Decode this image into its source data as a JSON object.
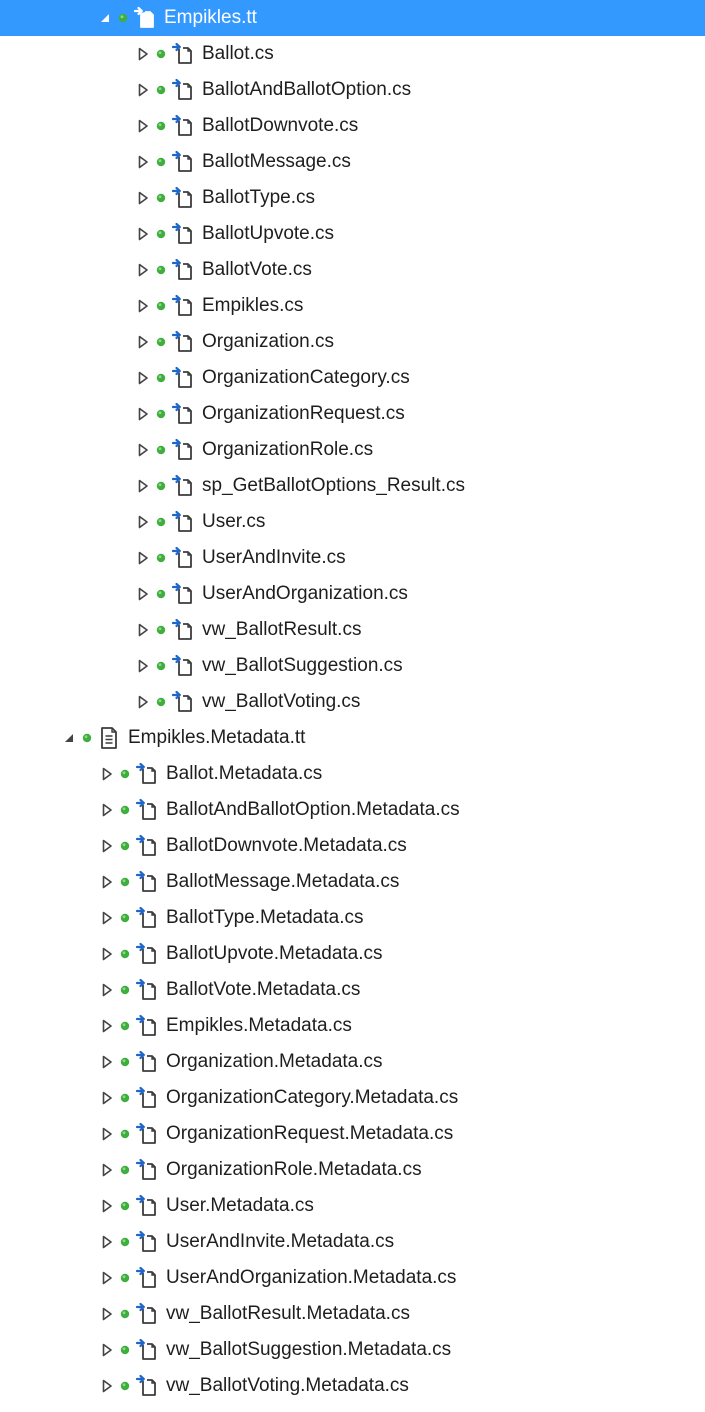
{
  "colors": {
    "selection_bg": "#3399ff",
    "selection_text": "#ffffff",
    "text": "#1e1e1e",
    "status_dot": "#3fae3f",
    "arrow_outline": "#444444",
    "icon_outline": "#3c3c3c",
    "icon_arrow": "#1e66c8"
  },
  "tree": {
    "root_cs": {
      "label": "Empikles.tt",
      "icon": "cs-generated-file-icon",
      "expanded": true,
      "selected": true,
      "children": [
        {
          "label": "Ballot.cs"
        },
        {
          "label": "BallotAndBallotOption.cs"
        },
        {
          "label": "BallotDownvote.cs"
        },
        {
          "label": "BallotMessage.cs"
        },
        {
          "label": "BallotType.cs"
        },
        {
          "label": "BallotUpvote.cs"
        },
        {
          "label": "BallotVote.cs"
        },
        {
          "label": "Empikles.cs"
        },
        {
          "label": "Organization.cs"
        },
        {
          "label": "OrganizationCategory.cs"
        },
        {
          "label": "OrganizationRequest.cs"
        },
        {
          "label": "OrganizationRole.cs"
        },
        {
          "label": "sp_GetBallotOptions_Result.cs"
        },
        {
          "label": "User.cs"
        },
        {
          "label": "UserAndInvite.cs"
        },
        {
          "label": "UserAndOrganization.cs"
        },
        {
          "label": "vw_BallotResult.cs"
        },
        {
          "label": "vw_BallotSuggestion.cs"
        },
        {
          "label": "vw_BallotVoting.cs"
        }
      ]
    },
    "root_meta": {
      "label": "Empikles.Metadata.tt",
      "icon": "text-template-file-icon",
      "expanded": true,
      "selected": false,
      "children": [
        {
          "label": "Ballot.Metadata.cs"
        },
        {
          "label": "BallotAndBallotOption.Metadata.cs"
        },
        {
          "label": "BallotDownvote.Metadata.cs"
        },
        {
          "label": "BallotMessage.Metadata.cs"
        },
        {
          "label": "BallotType.Metadata.cs"
        },
        {
          "label": "BallotUpvote.Metadata.cs"
        },
        {
          "label": "BallotVote.Metadata.cs"
        },
        {
          "label": "Empikles.Metadata.cs"
        },
        {
          "label": "Organization.Metadata.cs"
        },
        {
          "label": "OrganizationCategory.Metadata.cs"
        },
        {
          "label": "OrganizationRequest.Metadata.cs"
        },
        {
          "label": "OrganizationRole.Metadata.cs"
        },
        {
          "label": "User.Metadata.cs"
        },
        {
          "label": "UserAndInvite.Metadata.cs"
        },
        {
          "label": "UserAndOrganization.Metadata.cs"
        },
        {
          "label": "vw_BallotResult.Metadata.cs"
        },
        {
          "label": "vw_BallotSuggestion.Metadata.cs"
        },
        {
          "label": "vw_BallotVoting.Metadata.cs"
        }
      ]
    }
  }
}
